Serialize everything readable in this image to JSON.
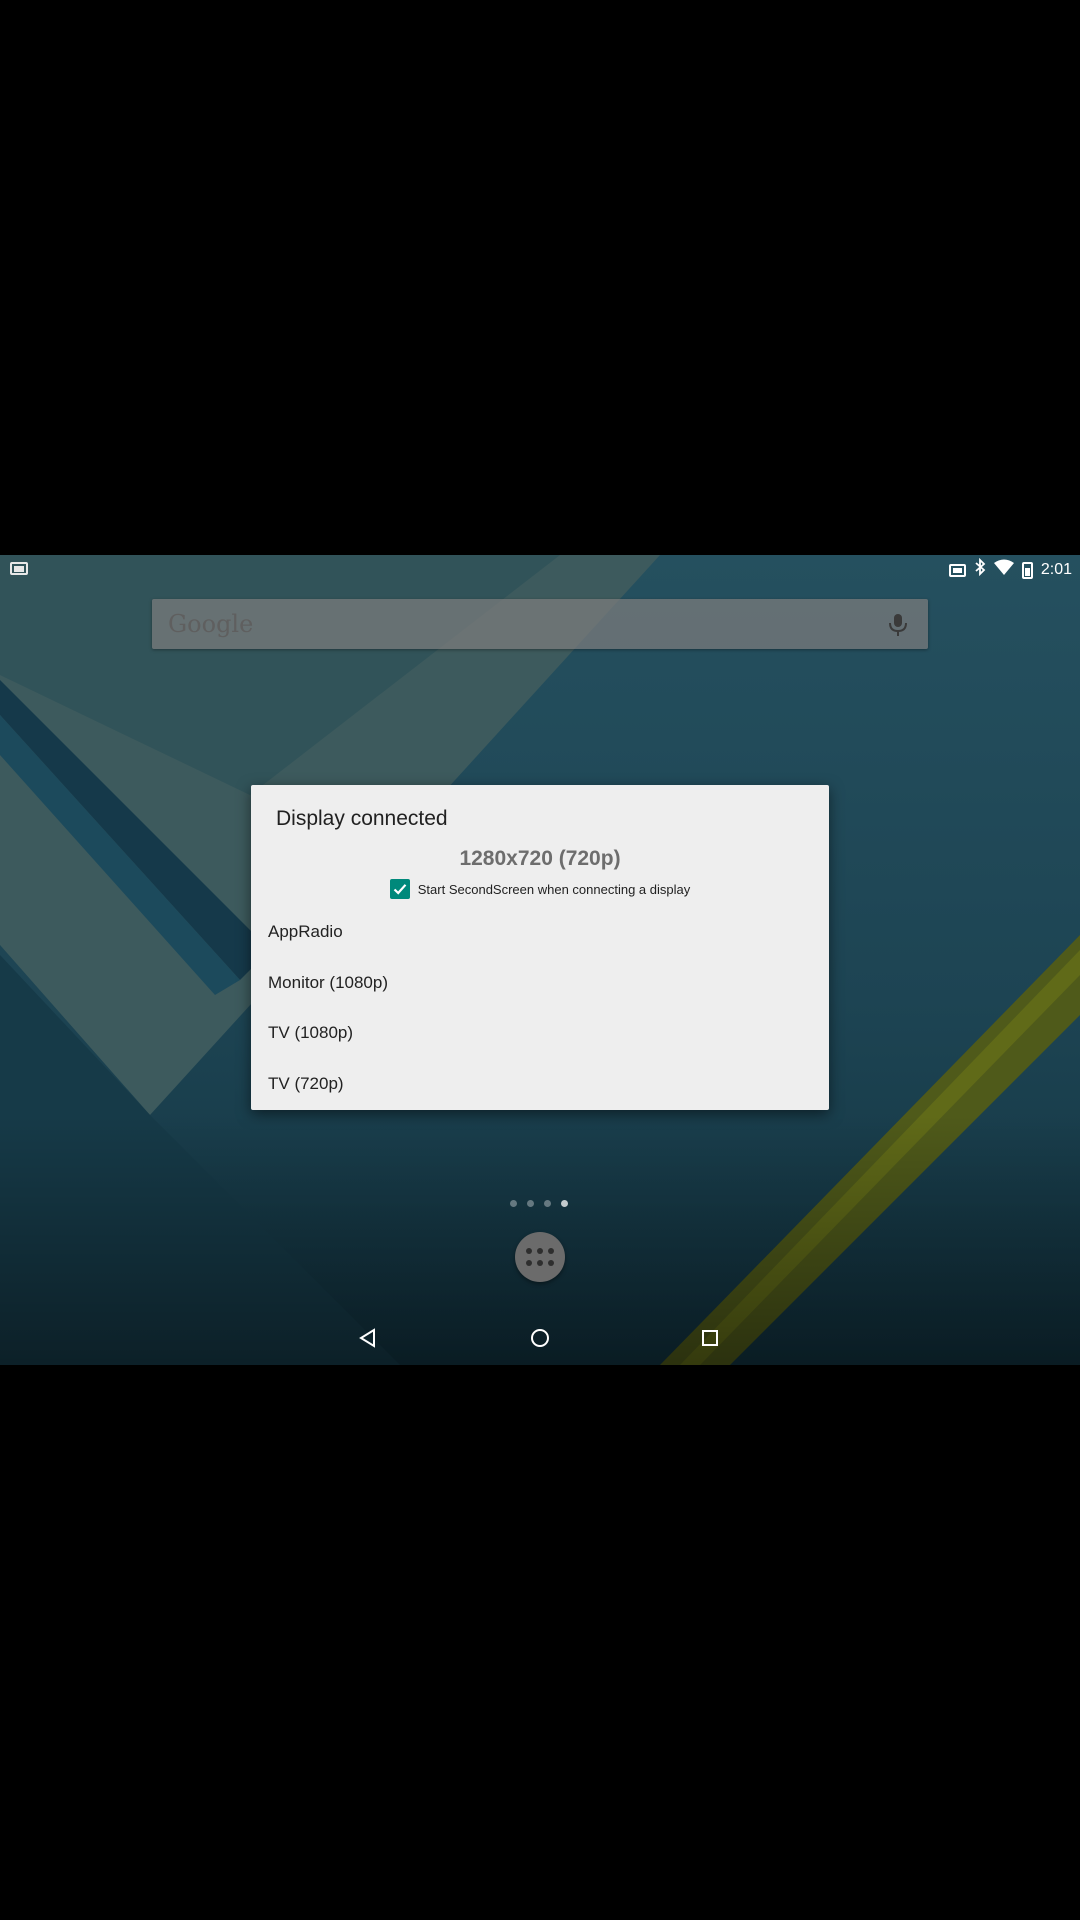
{
  "status_bar": {
    "time": "2:01",
    "icons": [
      "cast-icon",
      "cast-icon",
      "bluetooth-icon",
      "wifi-icon",
      "battery-icon"
    ]
  },
  "search": {
    "logo": "Google",
    "icon": "mic-icon"
  },
  "dialog": {
    "title": "Display connected",
    "resolution": "1280x720 (720p)",
    "checkbox": {
      "checked": true,
      "label": "Start SecondScreen when connecting a display"
    },
    "options": [
      "AppRadio",
      "Monitor (1080p)",
      "TV (1080p)",
      "TV (720p)"
    ],
    "accent_color": "#00897b"
  },
  "home": {
    "page_count": 4,
    "current_page": 4
  },
  "nav": {
    "icons": [
      "back-icon",
      "home-icon",
      "recents-icon"
    ]
  }
}
